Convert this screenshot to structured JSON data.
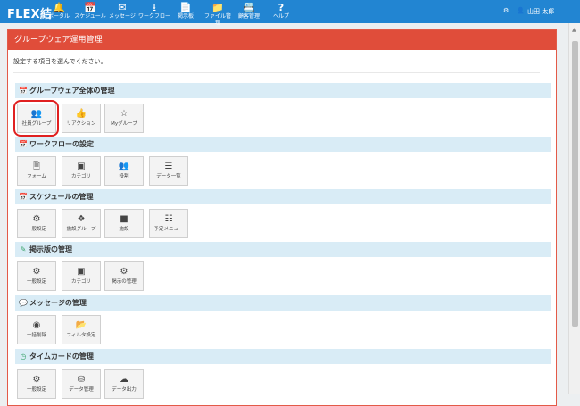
{
  "nav": {
    "logo": "FLEX結",
    "items": [
      {
        "label": "ポータル",
        "icon": "bell-icon"
      },
      {
        "label": "スケジュール",
        "icon": "calendar-icon"
      },
      {
        "label": "メッセージ",
        "icon": "envelope-icon"
      },
      {
        "label": "ワークフロー",
        "icon": "workflow-icon"
      },
      {
        "label": "掲示板",
        "icon": "document-icon"
      },
      {
        "label": "ファイル管理",
        "icon": "folder-icon"
      },
      {
        "label": "顧客管理",
        "icon": "contact-icon"
      },
      {
        "label": "ヘルプ",
        "icon": "help-icon"
      }
    ],
    "user": "山田 太郎"
  },
  "panel": {
    "title": "グループウェア運用管理",
    "intro": "設定する項目を選んでください。"
  },
  "sections": [
    {
      "title": "グループウェア全体の管理",
      "icon": "calendar-icon",
      "tiles": [
        {
          "label": "社員グループ",
          "icon": "users-icon"
        },
        {
          "label": "リアクション",
          "icon": "thumbs-up-icon"
        },
        {
          "label": "Myグループ",
          "icon": "star-icon"
        }
      ]
    },
    {
      "title": "ワークフローの設定",
      "icon": "calendar-icon",
      "tiles": [
        {
          "label": "フォーム",
          "icon": "file-icon"
        },
        {
          "label": "カテゴリ",
          "icon": "category-icon"
        },
        {
          "label": "役割",
          "icon": "users-icon"
        },
        {
          "label": "データ一覧",
          "icon": "list-icon"
        }
      ]
    },
    {
      "title": "スケジュールの管理",
      "icon": "calendar-icon",
      "tiles": [
        {
          "label": "一般設定",
          "icon": "gear-icon"
        },
        {
          "label": "施設グループ",
          "icon": "cubes-icon"
        },
        {
          "label": "施設",
          "icon": "cube-icon"
        },
        {
          "label": "予定メニュー",
          "icon": "menu-icon"
        }
      ]
    },
    {
      "title": "掲示版の管理",
      "icon": "edit-icon",
      "tiles": [
        {
          "label": "一般設定",
          "icon": "gear-icon"
        },
        {
          "label": "カテゴリ",
          "icon": "category-icon"
        },
        {
          "label": "掲示の管理",
          "icon": "gears-icon"
        }
      ]
    },
    {
      "title": "メッセージの管理",
      "icon": "chat-icon",
      "tiles": [
        {
          "label": "一括削除",
          "icon": "record-icon"
        },
        {
          "label": "フィルタ設定",
          "icon": "folder-icon"
        }
      ]
    },
    {
      "title": "タイムカードの管理",
      "icon": "clock-icon",
      "tiles": [
        {
          "label": "一般設定",
          "icon": "gear-icon"
        },
        {
          "label": "データ管理",
          "icon": "database-icon"
        },
        {
          "label": "データ出力",
          "icon": "cloud-download-icon"
        }
      ]
    }
  ]
}
